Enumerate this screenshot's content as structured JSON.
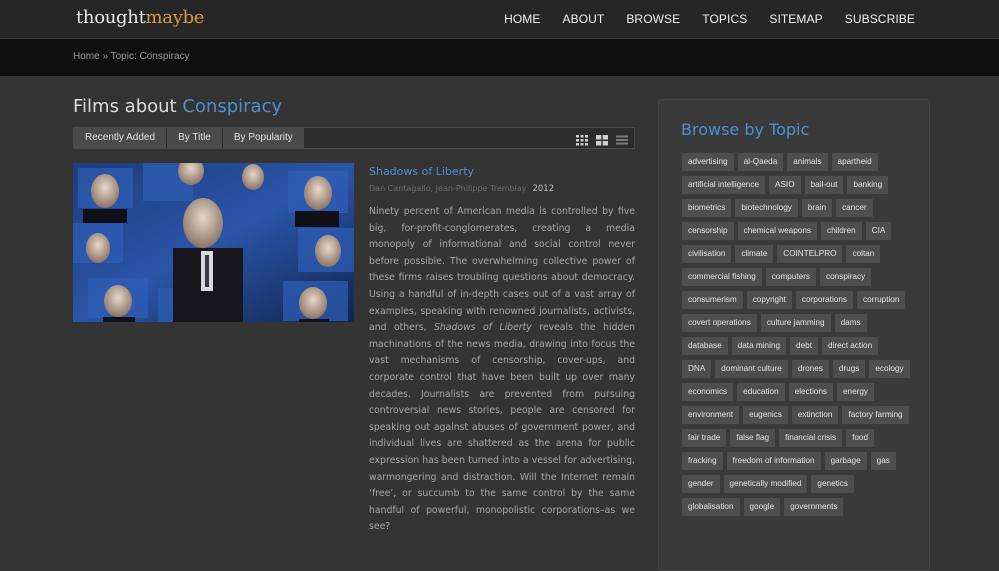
{
  "header": {
    "logo_part1": "thought",
    "logo_part2": "maybe",
    "nav": [
      "HOME",
      "ABOUT",
      "BROWSE",
      "TOPICS",
      "SITEMAP",
      "SUBSCRIBE"
    ]
  },
  "breadcrumb": "Home » Topic: Conspiracy",
  "main": {
    "title_prefix": "Films about ",
    "title_topic": "Conspiracy",
    "sort_options": [
      "Recently Added",
      "By Title",
      "By Popularity"
    ],
    "film": {
      "title": "Shadows of Liberty",
      "directors": "Dan Cantagallo, Jean-Philippe Tremblay",
      "year": "2012",
      "desc_part1": "Ninety percent of American media is controlled by five big, for-profit-conglomerates, creating a media monopoly of informational and social control never before possible. The overwhelming collective power of these firms raises troubling questions about democracy. Using a handful of in-depth cases out of a vast array of examples, speaking with renowned journalists, activists, and others, ",
      "desc_italic": "Shadows of Liberty",
      "desc_part2": " reveals the hidden machinations of the news media, drawing into focus the vast mechanisms of censorship, cover-ups, and corporate control that have been built up over many decades. Journalists are prevented from pursuing controversial news stories, people are censored for speaking out against abuses of government power, and individual lives are shattered as the arena for public expression has been turned into a vessel for advertising, warmongering and distraction. Will the Internet remain ‘free’, or succumb to the same control by the same handful of powerful, monopolistic corporations–as we see?"
    }
  },
  "sidebar": {
    "title": "Browse by Topic",
    "tags": [
      "advertising",
      "al-Qaeda",
      "animals",
      "apartheid",
      "artificial intelligence",
      "ASIO",
      "bail-out",
      "banking",
      "biometrics",
      "biotechnology",
      "brain",
      "cancer",
      "censorship",
      "chemical weapons",
      "children",
      "CIA",
      "civilisation",
      "climate",
      "COINTELPRO",
      "coltan",
      "commercial fishing",
      "computers",
      "conspiracy",
      "consumerism",
      "copyright",
      "corporations",
      "corruption",
      "covert operations",
      "culture jamming",
      "dams",
      "database",
      "data mining",
      "debt",
      "direct action",
      "DNA",
      "dominant culture",
      "drones",
      "drugs",
      "ecology",
      "economics",
      "education",
      "elections",
      "energy",
      "environment",
      "eugenics",
      "extinction",
      "factory farming",
      "fair trade",
      "false flag",
      "financial crisis",
      "food",
      "fracking",
      "freedom of information",
      "garbage",
      "gas",
      "gender",
      "genetically modified",
      "genetics",
      "globalisation",
      "google",
      "governments"
    ]
  },
  "colors": {
    "accent": "#4c8fd1",
    "logo_accent": "#d89a3a",
    "tag_bg": "#4e4e4e"
  }
}
